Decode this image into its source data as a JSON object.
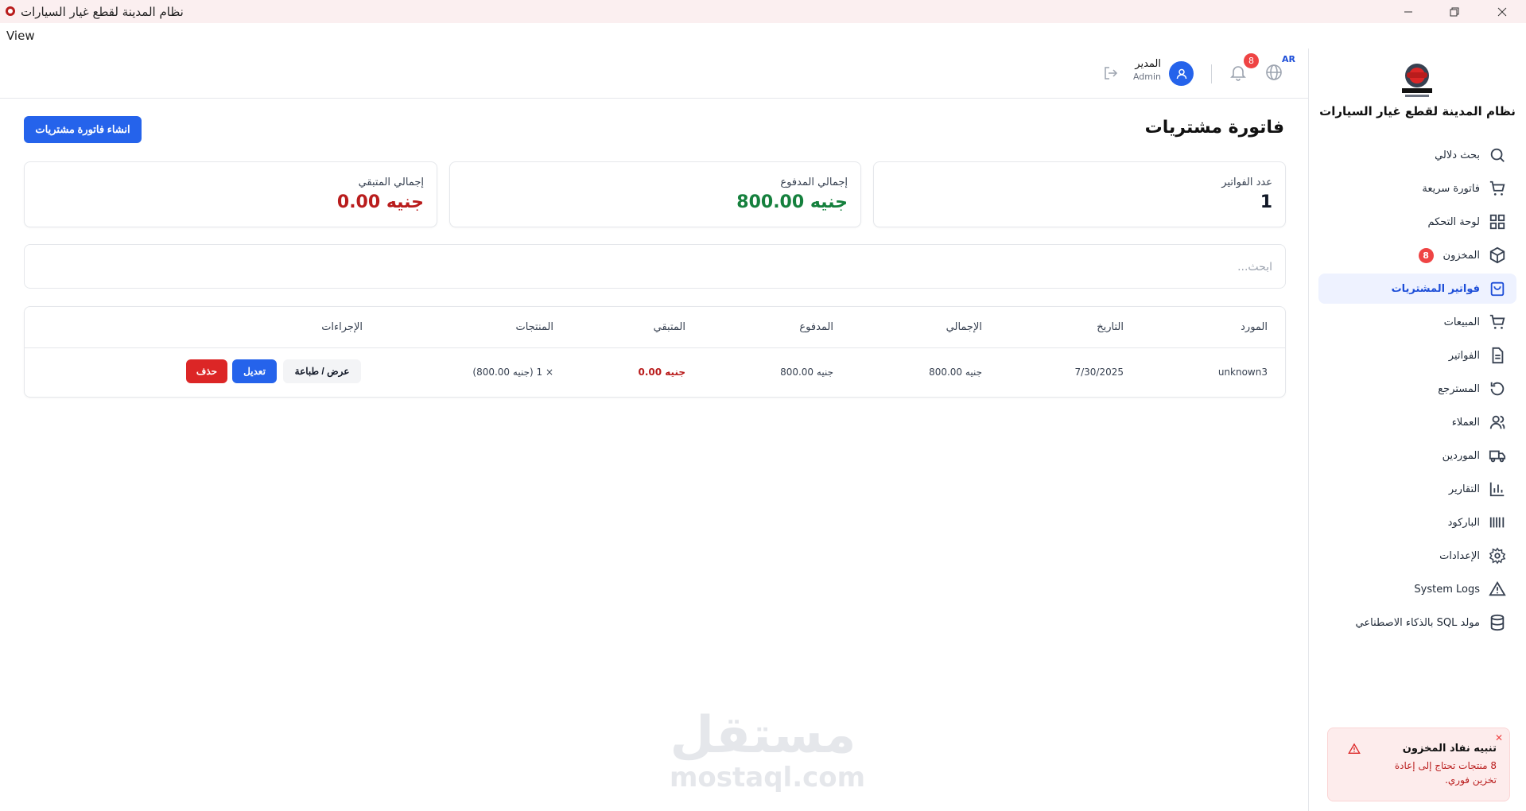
{
  "window": {
    "title": "نظام المدينة لقطع غيار السيارات",
    "menu_view": "View"
  },
  "sidebar": {
    "title": "نظام المدينة لقطع غيار السيارات",
    "items": [
      {
        "label": "بحث دلالي",
        "icon": "search-icon"
      },
      {
        "label": "فاتورة سريعة",
        "icon": "cart-icon"
      },
      {
        "label": "لوحة التحكم",
        "icon": "dashboard-icon"
      },
      {
        "label": "المخزون",
        "icon": "box-icon",
        "badge": "8"
      },
      {
        "label": "فواتير المشتريات",
        "icon": "shopping-bag-icon",
        "active": true
      },
      {
        "label": "المبيعات",
        "icon": "cart-icon"
      },
      {
        "label": "الفواتير",
        "icon": "file-icon"
      },
      {
        "label": "المسترجع",
        "icon": "rotate-icon"
      },
      {
        "label": "العملاء",
        "icon": "users-icon"
      },
      {
        "label": "الموردين",
        "icon": "truck-icon"
      },
      {
        "label": "التقارير",
        "icon": "bar-chart-icon"
      },
      {
        "label": "الباركود",
        "icon": "barcode-icon"
      },
      {
        "label": "الإعدادات",
        "icon": "gear-icon"
      },
      {
        "label": "System Logs",
        "icon": "warning-icon"
      },
      {
        "label": "مولد SQL بالذكاء الاصطناعي",
        "icon": "database-icon"
      }
    ]
  },
  "header": {
    "lang": "AR",
    "notifications_count": "8",
    "user_name": "المدير",
    "user_role": "Admin"
  },
  "page": {
    "title": "فاتورة مشتريات",
    "create_button": "انشاء فاتورة مشتريات",
    "search_placeholder": "ابحث..."
  },
  "stats": {
    "invoices_count_label": "عدد الفواتير",
    "invoices_count_value": "1",
    "total_paid_label": "إجمالي المدفوع",
    "total_paid_value": "جنيه 800.00",
    "total_remaining_label": "إجمالي المتبقي",
    "total_remaining_value": "جنيه 0.00"
  },
  "table": {
    "headers": {
      "supplier": "المورد",
      "date": "التاريخ",
      "total": "الإجمالي",
      "paid": "المدفوع",
      "remaining": "المتبقي",
      "products": "المنتجات",
      "actions": "الإجراءات"
    },
    "rows": [
      {
        "supplier": "unknown3",
        "date": "7/30/2025",
        "total": "جنيه 800.00",
        "paid": "جنيه 800.00",
        "remaining": "جنيه 0.00",
        "products": "× 1 (جنيه 800.00)",
        "view_print": "عرض / طباعة",
        "edit": "تعديل",
        "delete": "حذف"
      }
    ]
  },
  "toast": {
    "title": "تنبيه نفاد المخزون",
    "message": "8 منتجات تحتاج إلى إعادة تخزين فوري."
  },
  "watermark": {
    "arabic": "مستقل",
    "latin": "mostaql.com"
  },
  "colors": {
    "primary": "#2563eb",
    "success": "#15803d",
    "danger": "#b91c1c",
    "badge": "#ef4444"
  }
}
